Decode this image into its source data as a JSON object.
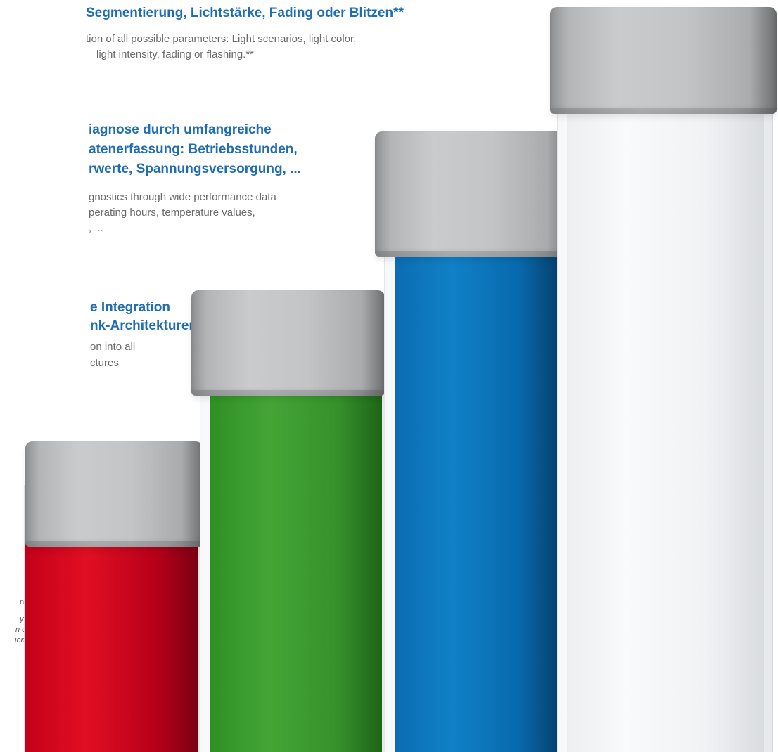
{
  "blocks": [
    {
      "heading": [
        "Segmentierung, Lichtstärke, Fading oder Blitzen**"
      ],
      "body": [
        "tion of all possible parameters: Light scenarios, light color,",
        "light intensity, fading or flashing.**"
      ]
    },
    {
      "heading": [
        "iagnose durch umfangreiche",
        "atenerfassung: Betriebsstunden,",
        "rwerte, Spannungsversorgung, ..."
      ],
      "body": [
        "gnostics through wide performance data",
        "perating hours, temperature values,",
        ", ..."
      ]
    },
    {
      "heading": [
        "e Integration",
        "nk-Architekturen"
      ],
      "body": [
        "on into all",
        "ctures"
      ]
    }
  ],
  "footnotes": {
    "line1": "nd",
    "italic": [
      "y",
      "n on",
      "ion"
    ]
  },
  "tubes": [
    {
      "name": "red",
      "color": "#d0021b"
    },
    {
      "name": "green",
      "color": "#3a9a2e"
    },
    {
      "name": "blue",
      "color": "#0a72b8"
    },
    {
      "name": "white",
      "color": "#f2f3f4"
    }
  ]
}
